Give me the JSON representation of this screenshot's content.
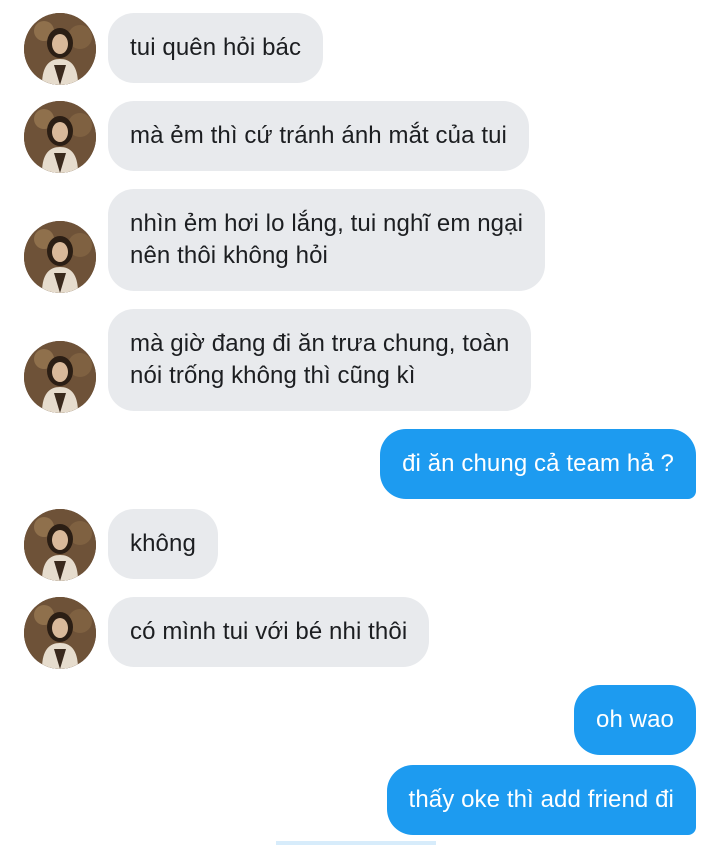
{
  "conversation": {
    "accent_color": "#1d9bf0",
    "incoming_bubble_color": "#e8eaed",
    "avatar_icon": "profile-photo-avatar",
    "messages": [
      {
        "side": "incoming",
        "lines": [
          "tui quên hỏi bác"
        ]
      },
      {
        "side": "incoming",
        "lines": [
          "mà ẻm thì cứ tránh ánh mắt của tui"
        ]
      },
      {
        "side": "incoming",
        "lines": [
          "nhìn ẻm hơi lo lắng, tui nghĩ em ngại",
          "nên thôi không hỏi"
        ]
      },
      {
        "side": "incoming",
        "lines": [
          "mà giờ đang đi ăn trưa chung, toàn",
          "nói trống không thì cũng kì"
        ]
      },
      {
        "side": "outgoing",
        "lines": [
          "đi ăn chung cả team hả ?"
        ]
      },
      {
        "side": "incoming",
        "lines": [
          "không"
        ]
      },
      {
        "side": "incoming",
        "lines": [
          "có mình tui với bé nhi thôi"
        ]
      },
      {
        "side": "outgoing",
        "lines": [
          "oh wao"
        ]
      },
      {
        "side": "outgoing",
        "lines": [
          "thấy oke thì add friend đi"
        ]
      }
    ]
  }
}
